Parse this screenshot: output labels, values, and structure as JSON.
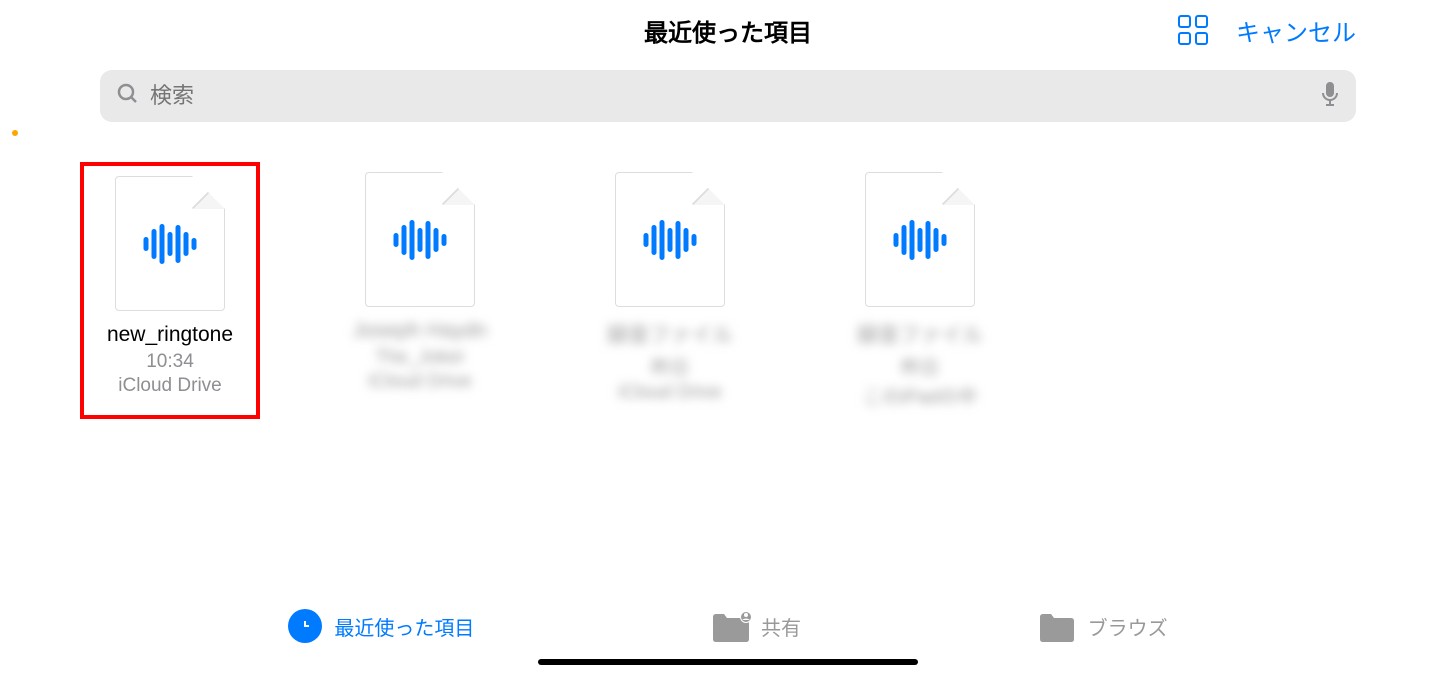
{
  "header": {
    "title": "最近使った項目",
    "cancel_label": "キャンセル"
  },
  "search": {
    "placeholder": "検索"
  },
  "files": [
    {
      "name": "new_ringtone",
      "time": "10:34",
      "location": "iCloud Drive",
      "highlighted": true,
      "blurred": false
    },
    {
      "name": "Joseph Haydn",
      "time": "The_Joker",
      "location": "iCloud Drive",
      "highlighted": false,
      "blurred": true
    },
    {
      "name": "録音ファイル",
      "time": "昨日",
      "location": "iCloud Drive",
      "highlighted": false,
      "blurred": true
    },
    {
      "name": "録音ファイル",
      "time": "昨日",
      "location": "このiPadの中",
      "highlighted": false,
      "blurred": true
    }
  ],
  "nav": {
    "recent": "最近使った項目",
    "shared": "共有",
    "browse": "ブラウズ"
  }
}
